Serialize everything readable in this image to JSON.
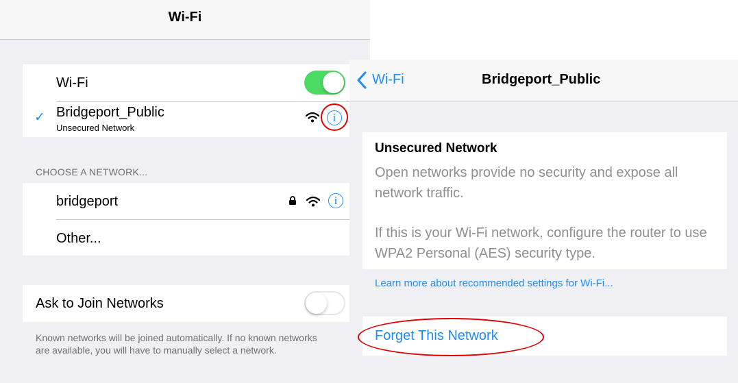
{
  "wifi_settings": {
    "title": "Wi-Fi",
    "wifi_toggle_label": "Wi-Fi",
    "wifi_enabled": true,
    "connected_network": {
      "name": "Bridgeport_Public",
      "subtitle": "Unsecured Network",
      "checkmark": "✓"
    },
    "section_header": "CHOOSE A NETWORK...",
    "networks": [
      {
        "name": "bridgeport",
        "locked": true
      }
    ],
    "other_label": "Other...",
    "ask_to_join_label": "Ask to Join Networks",
    "ask_to_join_enabled": false,
    "ask_to_join_footer": "Known networks will be joined automatically. If no known networks are available, you will have to manually select a network."
  },
  "network_detail": {
    "back_label": "Wi-Fi",
    "title": "Bridgeport_Public",
    "security_heading": "Unsecured Network",
    "security_desc_1": "Open networks provide no security and expose all network traffic.",
    "security_desc_2": "If this is your Wi-Fi network, configure the router to use WPA2 Personal (AES) security type.",
    "learn_more_link": "Learn more about recommended settings for Wi-Fi...",
    "forget_button": "Forget This Network"
  },
  "icons": {
    "info": "i",
    "wifi": "wifi-icon",
    "lock": "lock-icon",
    "back": "chevron-left-icon"
  },
  "colors": {
    "accent_blue": "#1a8cff",
    "toggle_on_green": "#4cd964",
    "highlight_red": "#e00000",
    "group_background": "#efeff4",
    "secondary_text": "#6d6d72"
  }
}
